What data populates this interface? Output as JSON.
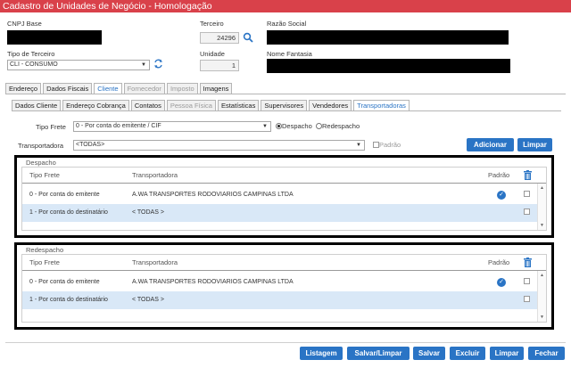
{
  "window": {
    "title": "Cadastro de Unidades de Negócio  - Homologação"
  },
  "header": {
    "cnpj_label": "CNPJ Base",
    "terceiro_label": "Terceiro",
    "terceiro_value": "24296",
    "razao_label": "Razão Social",
    "tipo_label": "Tipo de Terceiro",
    "tipo_value": "CLI - CONSUMO",
    "unidade_label": "Unidade",
    "unidade_value": "1",
    "fantasia_label": "Nome Fantasia"
  },
  "main_tabs": [
    {
      "label": "Endereço",
      "state": "normal"
    },
    {
      "label": "Dados Fiscais",
      "state": "normal"
    },
    {
      "label": "Cliente",
      "state": "active"
    },
    {
      "label": "Fornecedor",
      "state": "disabled"
    },
    {
      "label": "Imposto",
      "state": "disabled"
    },
    {
      "label": "Imagens",
      "state": "normal"
    }
  ],
  "sub_tabs": [
    {
      "label": "Dados Cliente",
      "state": "normal"
    },
    {
      "label": "Endereço Cobrança",
      "state": "normal"
    },
    {
      "label": "Contatos",
      "state": "normal"
    },
    {
      "label": "Pessoa Física",
      "state": "disabled"
    },
    {
      "label": "Estatísticas",
      "state": "normal"
    },
    {
      "label": "Supervisores",
      "state": "normal"
    },
    {
      "label": "Vendedores",
      "state": "normal"
    },
    {
      "label": "Transportadoras",
      "state": "active"
    }
  ],
  "form": {
    "tipo_frete_label": "Tipo Frete",
    "tipo_frete_value": "0 - Por conta do emitente / CIF",
    "despacho_label": "Despacho",
    "redespacho_label": "Redespacho",
    "transportadora_label": "Transportadora",
    "transportadora_value": "<TODAS>",
    "padrao_label": "Padrão",
    "adicionar_label": "Adicionar",
    "limpar_label": "Limpar"
  },
  "despacho": {
    "title": "Despacho",
    "columns": {
      "tipo": "Tipo Frete",
      "transp": "Transportadora",
      "padrao": "Padrão"
    },
    "rows": [
      {
        "tipo": "0 - Por conta do emitente",
        "transp": "A.WA TRANSPORTES RODOVIARIOS CAMPINAS LTDA",
        "padrao": true
      },
      {
        "tipo": "1 - Por conta do destinatário",
        "transp": "< TODAS >",
        "padrao": false
      }
    ]
  },
  "redespacho": {
    "title": "Redespacho",
    "columns": {
      "tipo": "Tipo Frete",
      "transp": "Transportadora",
      "padrao": "Padrão"
    },
    "rows": [
      {
        "tipo": "0 - Por conta do emitente",
        "transp": "A.WA TRANSPORTES RODOVIARIOS CAMPINAS LTDA",
        "padrao": true
      },
      {
        "tipo": "1 - Por conta do destinatário",
        "transp": "< TODAS >",
        "padrao": false
      }
    ]
  },
  "footer": {
    "listagem": "Listagem",
    "salvar_limpar": "Salvar/Limpar",
    "salvar": "Salvar",
    "excluir": "Excluir",
    "limpar": "Limpar",
    "fechar": "Fechar"
  },
  "icons": {
    "search": "search-icon",
    "refresh": "refresh-icon",
    "trash": "trash-icon",
    "check": "check-circle-icon"
  },
  "colors": {
    "title_bar": "#d9414a",
    "accent": "#2a74c5",
    "row_alt": "#d9e8f7"
  }
}
